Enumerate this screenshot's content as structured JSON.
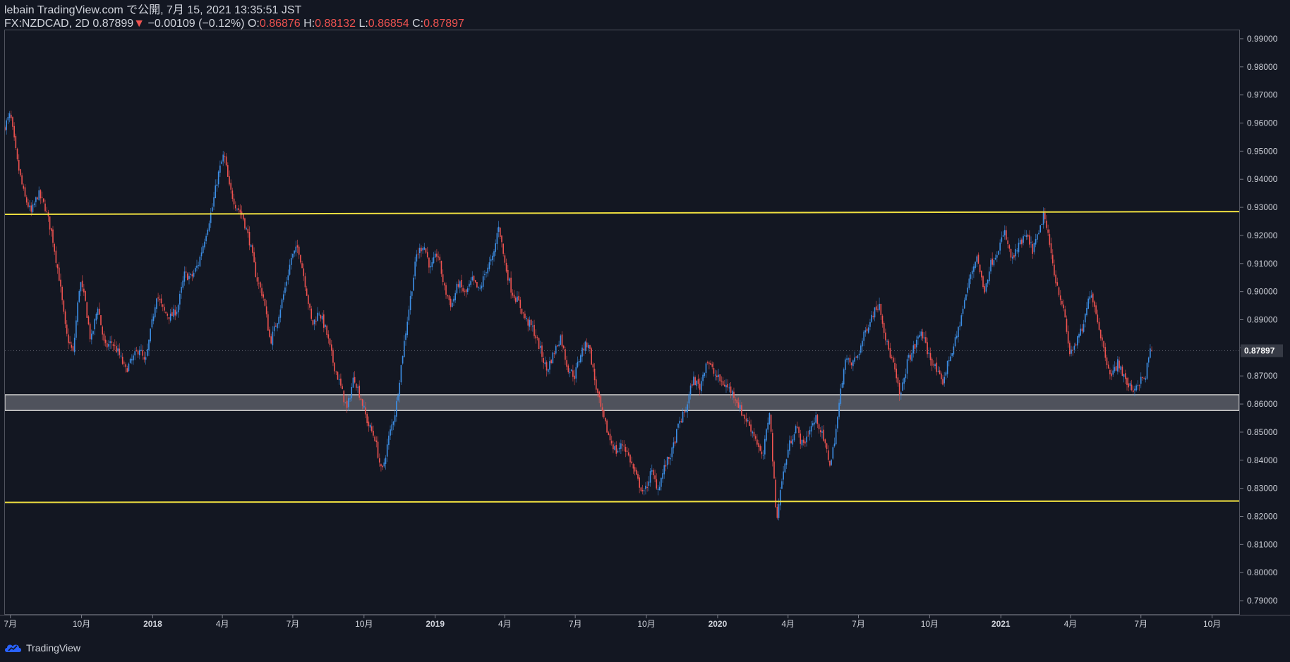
{
  "header": {
    "publisher_line": "lebain TradingView.com で公開, 7月 15, 2021 13:35:51 JST",
    "symbol": "FX:NZDCAD, 2D",
    "last": "0.87899",
    "down_arrow": "▼",
    "change": "−0.00109 (−0.12%)",
    "o_label": "O:",
    "o_value": "0.86876",
    "h_label": "H:",
    "h_value": "0.88132",
    "l_label": "L:",
    "l_value": "0.86854",
    "c_label": "C:",
    "c_value": "0.87897"
  },
  "footer": {
    "brand": "TradingView"
  },
  "colors": {
    "background": "#131722",
    "up": "#2962ff",
    "up_light": "#3d8fe6",
    "down": "#ef5350",
    "trendline": "#f0e040",
    "zone_fill": "#5a5d66",
    "zone_border": "#c8c8c8",
    "axis_text": "#d1d4dc",
    "price_label_bg": "#363a45"
  },
  "chart_data": {
    "type": "candlestick",
    "symbol": "FX:NZDCAD",
    "timeframe": "2D",
    "ylim": [
      0.785,
      0.993
    ],
    "y_ticks": [
      "0.99000",
      "0.98000",
      "0.97000",
      "0.96000",
      "0.95000",
      "0.94000",
      "0.93000",
      "0.92000",
      "0.91000",
      "0.90000",
      "0.89000",
      "0.88000",
      "0.87000",
      "0.86000",
      "0.85000",
      "0.84000",
      "0.83000",
      "0.82000",
      "0.81000",
      "0.80000",
      "0.79000"
    ],
    "current_price_label": "0.87897",
    "current_price": 0.87897,
    "x_range": [
      "2017-06-24",
      "2021-11-05"
    ],
    "x_ticks": [
      {
        "label": "7月",
        "date": "2017-07-01"
      },
      {
        "label": "10月",
        "date": "2017-10-01"
      },
      {
        "label": "2018",
        "date": "2018-01-01"
      },
      {
        "label": "4月",
        "date": "2018-04-01"
      },
      {
        "label": "7月",
        "date": "2018-07-01"
      },
      {
        "label": "10月",
        "date": "2018-10-01"
      },
      {
        "label": "2019",
        "date": "2019-01-01"
      },
      {
        "label": "4月",
        "date": "2019-04-01"
      },
      {
        "label": "7月",
        "date": "2019-07-01"
      },
      {
        "label": "10月",
        "date": "2019-10-01"
      },
      {
        "label": "2020",
        "date": "2020-01-01"
      },
      {
        "label": "4月",
        "date": "2020-04-01"
      },
      {
        "label": "7月",
        "date": "2020-07-01"
      },
      {
        "label": "10月",
        "date": "2020-10-01"
      },
      {
        "label": "2021",
        "date": "2021-01-01"
      },
      {
        "label": "4月",
        "date": "2021-04-01"
      },
      {
        "label": "7月",
        "date": "2021-07-01"
      },
      {
        "label": "10月",
        "date": "2021-10-01"
      }
    ],
    "price_path": [
      [
        "2017-06-24",
        0.958
      ],
      [
        "2017-07-03",
        0.963
      ],
      [
        "2017-07-12",
        0.946
      ],
      [
        "2017-07-21",
        0.934
      ],
      [
        "2017-07-30",
        0.928
      ],
      [
        "2017-08-08",
        0.935
      ],
      [
        "2017-08-17",
        0.93
      ],
      [
        "2017-08-26",
        0.92
      ],
      [
        "2017-09-04",
        0.905
      ],
      [
        "2017-09-13",
        0.885
      ],
      [
        "2017-09-22",
        0.878
      ],
      [
        "2017-10-01",
        0.904
      ],
      [
        "2017-10-08",
        0.896
      ],
      [
        "2017-10-15",
        0.882
      ],
      [
        "2017-10-24",
        0.895
      ],
      [
        "2017-11-02",
        0.88
      ],
      [
        "2017-11-11",
        0.882
      ],
      [
        "2017-11-20",
        0.878
      ],
      [
        "2017-11-29",
        0.872
      ],
      [
        "2017-12-08",
        0.876
      ],
      [
        "2017-12-17",
        0.88
      ],
      [
        "2017-12-24",
        0.874
      ],
      [
        "2018-01-01",
        0.887
      ],
      [
        "2018-01-08",
        0.899
      ],
      [
        "2018-01-17",
        0.893
      ],
      [
        "2018-01-26",
        0.891
      ],
      [
        "2018-02-04",
        0.894
      ],
      [
        "2018-02-13",
        0.906
      ],
      [
        "2018-02-22",
        0.905
      ],
      [
        "2018-03-03",
        0.91
      ],
      [
        "2018-03-12",
        0.92
      ],
      [
        "2018-03-21",
        0.93
      ],
      [
        "2018-03-28",
        0.941
      ],
      [
        "2018-04-05",
        0.949
      ],
      [
        "2018-04-12",
        0.937
      ],
      [
        "2018-04-20",
        0.931
      ],
      [
        "2018-04-29",
        0.927
      ],
      [
        "2018-05-08",
        0.918
      ],
      [
        "2018-05-17",
        0.905
      ],
      [
        "2018-05-26",
        0.898
      ],
      [
        "2018-06-04",
        0.882
      ],
      [
        "2018-06-13",
        0.89
      ],
      [
        "2018-06-22",
        0.9
      ],
      [
        "2018-07-01",
        0.912
      ],
      [
        "2018-07-10",
        0.916
      ],
      [
        "2018-07-19",
        0.903
      ],
      [
        "2018-07-28",
        0.888
      ],
      [
        "2018-08-06",
        0.893
      ],
      [
        "2018-08-15",
        0.886
      ],
      [
        "2018-08-24",
        0.875
      ],
      [
        "2018-09-02",
        0.867
      ],
      [
        "2018-09-11",
        0.858
      ],
      [
        "2018-09-20",
        0.87
      ],
      [
        "2018-09-29",
        0.862
      ],
      [
        "2018-10-08",
        0.853
      ],
      [
        "2018-10-17",
        0.848
      ],
      [
        "2018-10-26",
        0.835
      ],
      [
        "2018-11-04",
        0.848
      ],
      [
        "2018-11-13",
        0.858
      ],
      [
        "2018-11-22",
        0.878
      ],
      [
        "2018-12-01",
        0.896
      ],
      [
        "2018-12-10",
        0.913
      ],
      [
        "2018-12-19",
        0.917
      ],
      [
        "2018-12-28",
        0.908
      ],
      [
        "2019-01-06",
        0.914
      ],
      [
        "2019-01-15",
        0.901
      ],
      [
        "2019-01-24",
        0.895
      ],
      [
        "2019-02-02",
        0.903
      ],
      [
        "2019-02-11",
        0.899
      ],
      [
        "2019-02-20",
        0.904
      ],
      [
        "2019-03-01",
        0.9
      ],
      [
        "2019-03-10",
        0.908
      ],
      [
        "2019-03-19",
        0.912
      ],
      [
        "2019-03-26",
        0.924
      ],
      [
        "2019-04-03",
        0.91
      ],
      [
        "2019-04-12",
        0.9
      ],
      [
        "2019-04-21",
        0.896
      ],
      [
        "2019-04-30",
        0.89
      ],
      [
        "2019-05-09",
        0.887
      ],
      [
        "2019-05-18",
        0.88
      ],
      [
        "2019-05-27",
        0.872
      ],
      [
        "2019-06-05",
        0.878
      ],
      [
        "2019-06-14",
        0.884
      ],
      [
        "2019-06-23",
        0.873
      ],
      [
        "2019-07-02",
        0.87
      ],
      [
        "2019-07-11",
        0.879
      ],
      [
        "2019-07-20",
        0.882
      ],
      [
        "2019-07-29",
        0.867
      ],
      [
        "2019-08-07",
        0.856
      ],
      [
        "2019-08-16",
        0.848
      ],
      [
        "2019-08-25",
        0.843
      ],
      [
        "2019-09-03",
        0.846
      ],
      [
        "2019-09-12",
        0.84
      ],
      [
        "2019-09-21",
        0.833
      ],
      [
        "2019-09-30",
        0.828
      ],
      [
        "2019-10-09",
        0.836
      ],
      [
        "2019-10-18",
        0.83
      ],
      [
        "2019-10-27",
        0.838
      ],
      [
        "2019-11-05",
        0.843
      ],
      [
        "2019-11-14",
        0.853
      ],
      [
        "2019-11-23",
        0.858
      ],
      [
        "2019-12-02",
        0.869
      ],
      [
        "2019-12-11",
        0.866
      ],
      [
        "2019-12-20",
        0.876
      ],
      [
        "2019-12-29",
        0.871
      ],
      [
        "2020-01-07",
        0.868
      ],
      [
        "2020-01-16",
        0.866
      ],
      [
        "2020-01-25",
        0.863
      ],
      [
        "2020-02-03",
        0.857
      ],
      [
        "2020-02-12",
        0.853
      ],
      [
        "2020-02-21",
        0.848
      ],
      [
        "2020-03-01",
        0.84
      ],
      [
        "2020-03-10",
        0.858
      ],
      [
        "2020-03-19",
        0.819
      ],
      [
        "2020-03-26",
        0.833
      ],
      [
        "2020-04-04",
        0.845
      ],
      [
        "2020-04-13",
        0.852
      ],
      [
        "2020-04-22",
        0.845
      ],
      [
        "2020-05-01",
        0.851
      ],
      [
        "2020-05-10",
        0.855
      ],
      [
        "2020-05-19",
        0.847
      ],
      [
        "2020-05-28",
        0.838
      ],
      [
        "2020-06-06",
        0.855
      ],
      [
        "2020-06-15",
        0.876
      ],
      [
        "2020-06-24",
        0.874
      ],
      [
        "2020-07-03",
        0.878
      ],
      [
        "2020-07-12",
        0.886
      ],
      [
        "2020-07-21",
        0.892
      ],
      [
        "2020-07-30",
        0.896
      ],
      [
        "2020-08-08",
        0.882
      ],
      [
        "2020-08-17",
        0.874
      ],
      [
        "2020-08-26",
        0.862
      ],
      [
        "2020-09-04",
        0.875
      ],
      [
        "2020-09-13",
        0.88
      ],
      [
        "2020-09-22",
        0.886
      ],
      [
        "2020-10-01",
        0.878
      ],
      [
        "2020-10-10",
        0.873
      ],
      [
        "2020-10-19",
        0.867
      ],
      [
        "2020-10-28",
        0.876
      ],
      [
        "2020-11-06",
        0.883
      ],
      [
        "2020-11-15",
        0.894
      ],
      [
        "2020-11-24",
        0.905
      ],
      [
        "2020-12-03",
        0.913
      ],
      [
        "2020-12-12",
        0.9
      ],
      [
        "2020-12-21",
        0.91
      ],
      [
        "2020-12-30",
        0.915
      ],
      [
        "2021-01-08",
        0.921
      ],
      [
        "2021-01-17",
        0.911
      ],
      [
        "2021-01-26",
        0.916
      ],
      [
        "2021-02-04",
        0.92
      ],
      [
        "2021-02-13",
        0.915
      ],
      [
        "2021-02-22",
        0.921
      ],
      [
        "2021-02-27",
        0.928
      ],
      [
        "2021-03-06",
        0.918
      ],
      [
        "2021-03-15",
        0.904
      ],
      [
        "2021-03-24",
        0.895
      ],
      [
        "2021-04-02",
        0.878
      ],
      [
        "2021-04-11",
        0.882
      ],
      [
        "2021-04-20",
        0.888
      ],
      [
        "2021-04-29",
        0.901
      ],
      [
        "2021-05-08",
        0.89
      ],
      [
        "2021-05-17",
        0.878
      ],
      [
        "2021-05-26",
        0.87
      ],
      [
        "2021-06-04",
        0.875
      ],
      [
        "2021-06-13",
        0.868
      ],
      [
        "2021-06-22",
        0.865
      ],
      [
        "2021-07-01",
        0.868
      ],
      [
        "2021-07-08",
        0.869
      ],
      [
        "2021-07-15",
        0.879
      ]
    ],
    "overlays": {
      "upper_trendline": {
        "from": [
          "2017-06-24",
          0.9275
        ],
        "to": [
          "2021-11-05",
          0.9285
        ]
      },
      "lower_trendline": {
        "from": [
          "2017-06-24",
          0.825
        ],
        "to": [
          "2021-11-05",
          0.8255
        ]
      },
      "support_zone": {
        "top": 0.8633,
        "bottom": 0.8577
      }
    }
  }
}
